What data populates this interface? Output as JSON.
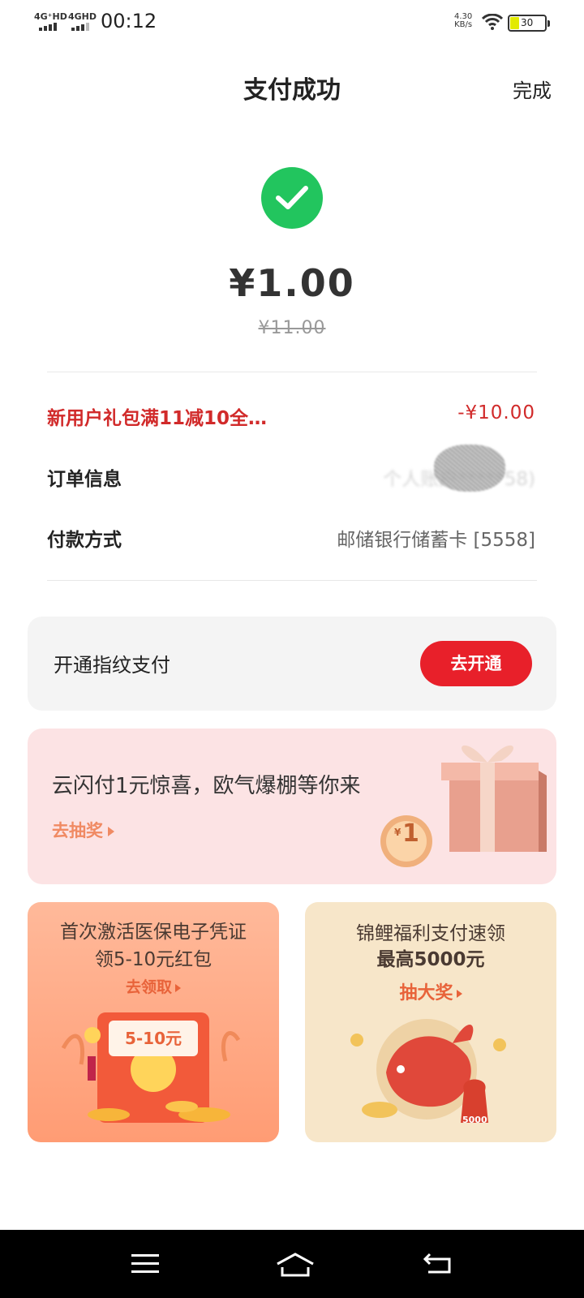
{
  "status_bar": {
    "signal_1": "4G⁺HD",
    "signal_2": "4GHD",
    "time": "00:12",
    "speed_value": "4.30",
    "speed_unit": "KB/s",
    "battery": "30"
  },
  "header": {
    "title": "支付成功",
    "done_label": "完成"
  },
  "payment": {
    "amount": "¥1.00",
    "original_amount": "¥11.00"
  },
  "details": {
    "promo_label": "新用户礼包满11减10全…",
    "promo_value": "-¥10.00",
    "order_label": "订单信息",
    "order_value": "个人账户*****58)",
    "method_label": "付款方式",
    "method_value": "邮储银行储蓄卡 [5558]"
  },
  "fingerprint": {
    "label": "开通指纹支付",
    "button": "去开通"
  },
  "promo_banner": {
    "title": "云闪付1元惊喜，欧气爆棚等你来",
    "link": "去抽奖",
    "coin_text": "1",
    "coin_symbol": "¥"
  },
  "card_left": {
    "title_line1": "首次激活医保电子凭证",
    "title_line2": "领5-10元红包",
    "link": "去领取",
    "tag": "5-10元"
  },
  "card_right": {
    "title_line1": "锦鲤福利支付速领",
    "title_line2": "最高5000元",
    "link": "抽大奖",
    "bag_text": "5000"
  },
  "colors": {
    "success_green": "#22c55e",
    "accent_red": "#e8202a",
    "promo_red": "#d12a2a"
  }
}
